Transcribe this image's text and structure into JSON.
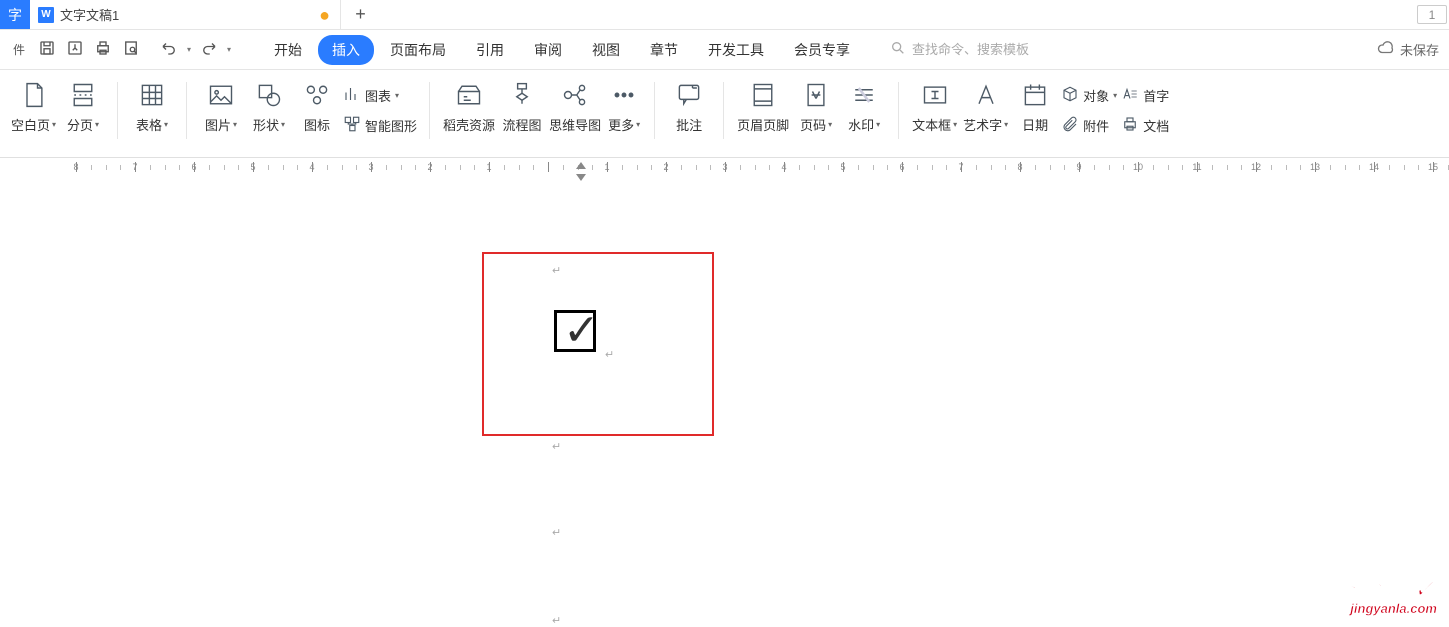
{
  "tabbar": {
    "home_glyph": "字",
    "doc_icon_glyph": "W",
    "doc_title": "文字文稿1",
    "dirty_dot": "●",
    "plus": "+",
    "right_icon": "1"
  },
  "quick": {
    "file_label": "件",
    "undo_caret": "▾",
    "redo_caret": "▾"
  },
  "menu": {
    "tabs": [
      "开始",
      "插入",
      "页面布局",
      "引用",
      "审阅",
      "视图",
      "章节",
      "开发工具",
      "会员专享"
    ],
    "active_index": 1
  },
  "search": {
    "placeholder": "查找命令、搜索模板"
  },
  "save_status": "未保存",
  "ribbon": {
    "blank_page": "空白页",
    "page_break": "分页",
    "table": "表格",
    "picture": "图片",
    "shape": "形状",
    "icon": "图标",
    "chart": "图表",
    "smart_art": "智能图形",
    "resource": "稻壳资源",
    "flowchart": "流程图",
    "mindmap": "思维导图",
    "more": "更多",
    "comment": "批注",
    "header_footer": "页眉页脚",
    "page_number": "页码",
    "watermark": "水印",
    "textbox": "文本框",
    "wordart": "艺术字",
    "date": "日期",
    "object": "对象",
    "attachment": "附件",
    "dropcap": "首字",
    "doc_parts": "文档"
  },
  "canvas": {
    "para_mark": "↵",
    "check_symbol": "✓"
  },
  "watermark": {
    "line1": "经验啦",
    "excl": "✓",
    "line2": "jingyanla.com"
  },
  "ruler": {
    "labels": [
      "8",
      "7",
      "6",
      "5",
      "4",
      "3",
      "2",
      "1",
      "",
      "1",
      "2",
      "3",
      "4",
      "5",
      "6",
      "7",
      "8",
      "9",
      "10",
      "11",
      "12",
      "13",
      "14",
      "15"
    ]
  }
}
